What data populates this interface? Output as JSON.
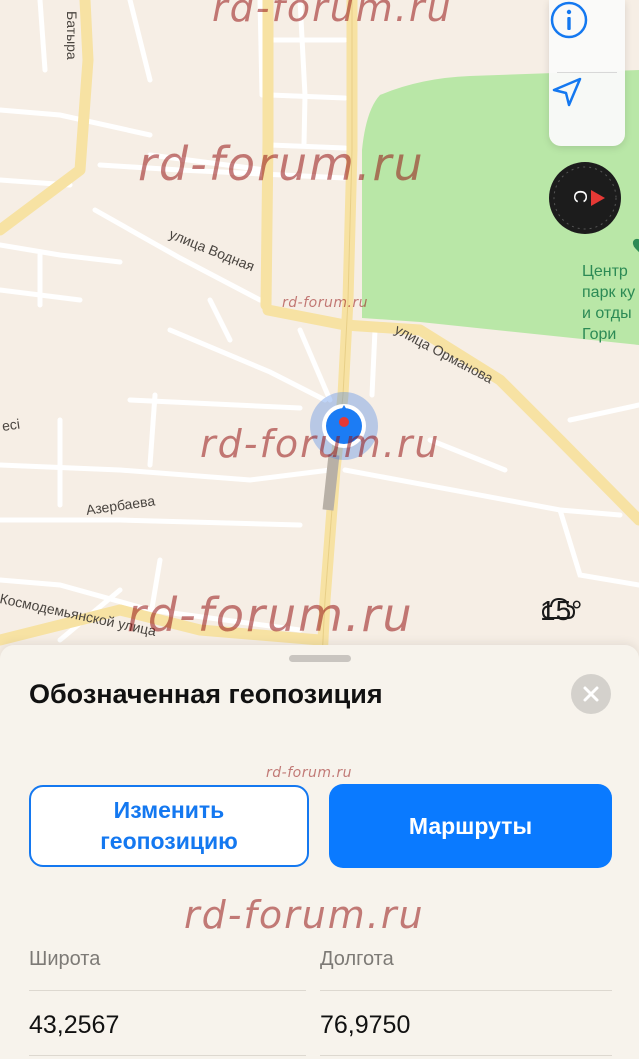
{
  "map": {
    "streets": {
      "batyra": "Батыра",
      "vodnaya": "улица Водная",
      "ormanova": "улица Орманова",
      "esi": "есі",
      "azerbaeva": "Азербаева",
      "kosmodemyanskoy": "Космодемьянской улица"
    },
    "park_label_lines": [
      "Центр",
      "парк ку",
      "и отды",
      "Гори"
    ],
    "compass_letter": "С",
    "weather": {
      "icon": "cloud-icon",
      "temperature": "15°"
    },
    "watermark": "rd-forum.ru"
  },
  "controls": {
    "info_icon": "info-icon",
    "location_icon": "location-arrow-icon"
  },
  "sheet": {
    "title": "Обозначенная геопозиция",
    "close_icon": "close-icon",
    "edit_button": "Изменить\nгеопозицию",
    "routes_button": "Маршруты",
    "latitude_label": "Широта",
    "longitude_label": "Долгота",
    "latitude_value": "43,2567",
    "longitude_value": "76,9750"
  },
  "colors": {
    "accent": "#0a7aff",
    "park": "#b9e7a7",
    "major_road": "#f7e2a3",
    "minor_road": "#ffffff",
    "watermark": "#961414"
  }
}
